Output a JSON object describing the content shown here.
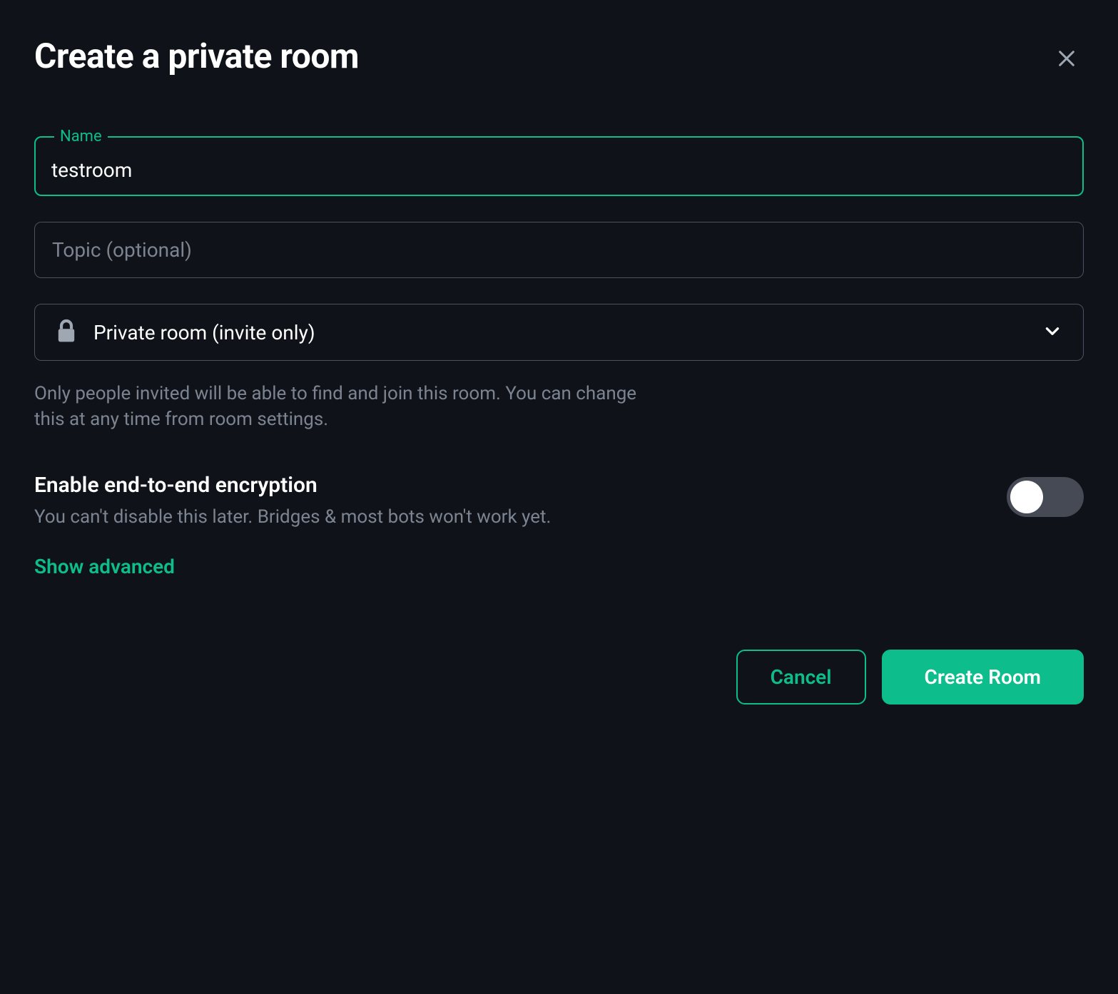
{
  "dialog": {
    "title": "Create a private room",
    "name_field": {
      "label": "Name",
      "value": "testroom"
    },
    "topic_field": {
      "placeholder": "Topic (optional)",
      "value": ""
    },
    "visibility": {
      "selected": "Private room (invite only)",
      "description": "Only people invited will be able to find and join this room. You can change this at any time from room settings."
    },
    "encryption": {
      "title": "Enable end-to-end encryption",
      "subtitle": "You can't disable this later. Bridges & most bots won't work yet.",
      "enabled": false
    },
    "show_advanced_label": "Show advanced",
    "actions": {
      "cancel": "Cancel",
      "create": "Create Room"
    }
  }
}
